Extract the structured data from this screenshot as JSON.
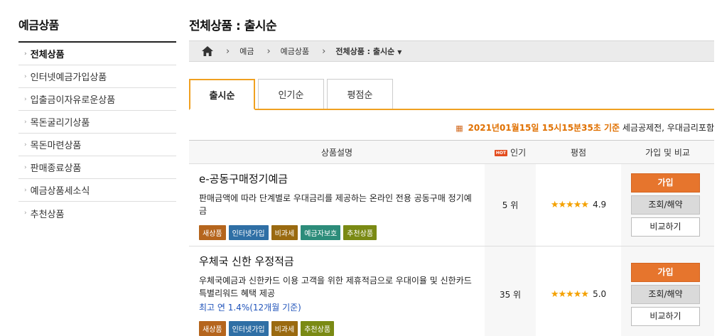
{
  "sidebar": {
    "title": "예금상품",
    "items": [
      {
        "label": "전체상품"
      },
      {
        "label": "인터넷예금가입상품"
      },
      {
        "label": "입출금이자유로운상품"
      },
      {
        "label": "목돈굴리기상품"
      },
      {
        "label": "목돈마련상품"
      },
      {
        "label": "판매종료상품"
      },
      {
        "label": "예금상품세소식"
      },
      {
        "label": "추천상품"
      }
    ]
  },
  "main": {
    "title": "전체상품 : 출시순",
    "breadcrumb": [
      "예금",
      "예금상품",
      "전체상품 : 출시순"
    ],
    "tabs": [
      "출시순",
      "인기순",
      "평점순"
    ],
    "timestamp": {
      "date": "2021년01월15일 15시15분35초 기준",
      "note": "세금공제전, 우대금리포함"
    },
    "table": {
      "headers": {
        "desc": "상품설명",
        "hot": "HOT",
        "pop": "인기",
        "rating": "평점",
        "action": "가입 및 비교"
      },
      "rows": [
        {
          "name": "e-공동구매정기예금",
          "desc": "판매금액에 따라 단계별로 우대금리를 제공하는 온라인 전용 공동구매 정기예금",
          "extra": "",
          "badges": [
            "새상품",
            "인터넷가입",
            "비과세",
            "예금자보호",
            "추천상품"
          ],
          "rank": "5 위",
          "stars": "★★★★★",
          "score": "4.9"
        },
        {
          "name": "우체국 신한 우정적금",
          "desc": "우체국예금과 신한카드 이용 고객을 위한 제휴적금으로 우대이율 및 신한카드 특별리워드 혜택 제공",
          "extra": "최고 연 1.4%(12개월 기준)",
          "badges": [
            "새상품",
            "인터넷가입",
            "비과세",
            "추천상품"
          ],
          "rank": "35 위",
          "stars": "★★★★★",
          "score": "5.0"
        }
      ],
      "buttons": {
        "join": "가입",
        "view": "조회/해약",
        "compare": "비교하기"
      }
    }
  },
  "colors": {
    "accent": "#f0a020",
    "join_button": "#e6752d",
    "date_text": "#e07000"
  }
}
